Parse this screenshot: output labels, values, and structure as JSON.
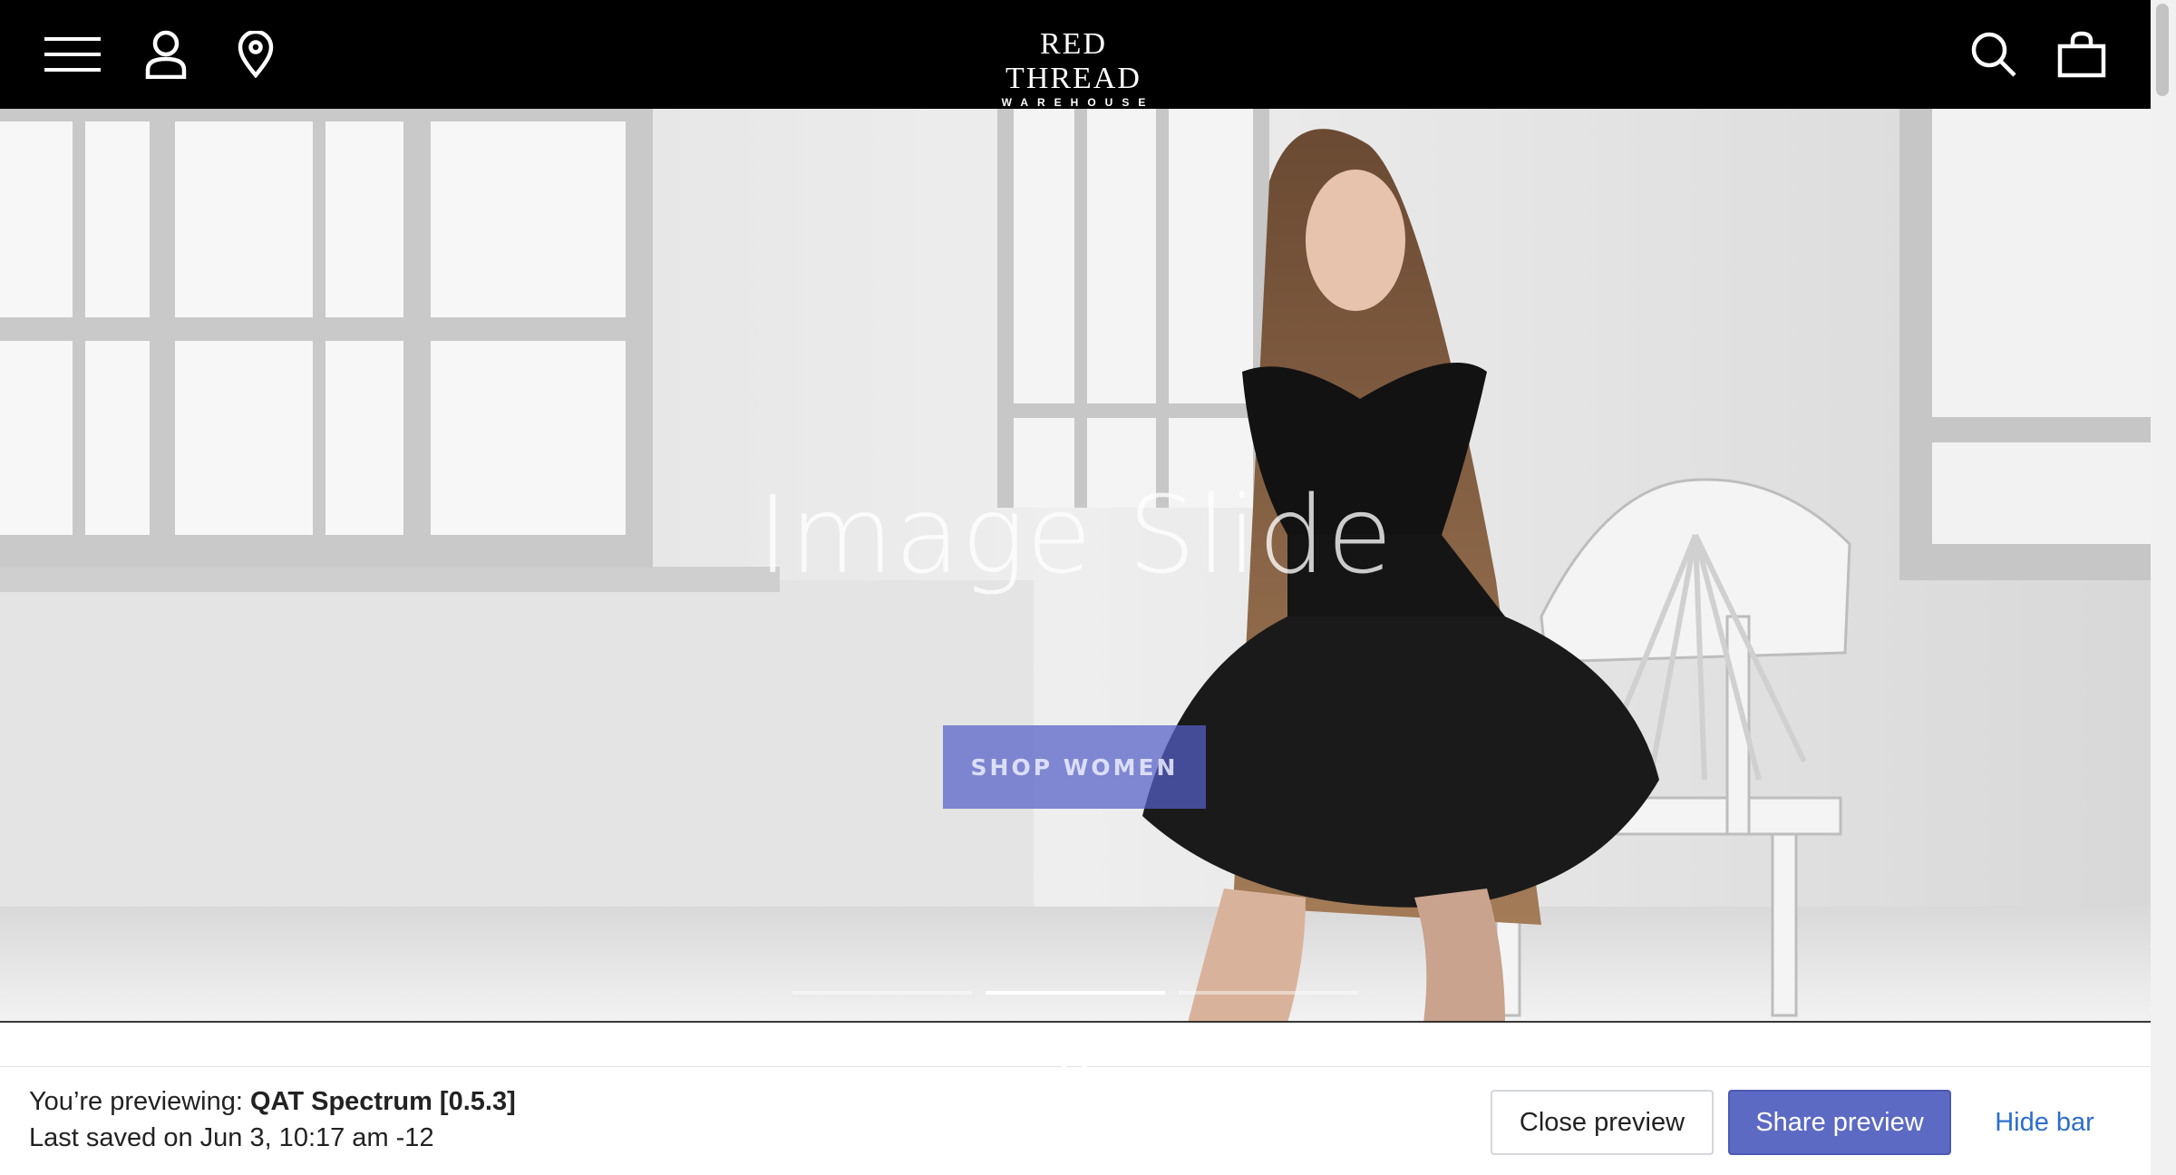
{
  "header": {
    "logo_line1": "RED THREAD",
    "logo_line2": "WAREHOUSE",
    "icons": [
      "menu-icon",
      "account-icon",
      "location-pin-icon",
      "search-icon",
      "shopping-bag-icon"
    ]
  },
  "hero": {
    "slide_title": "Image Slide",
    "cta_label": "SHOP WOMEN",
    "slide_indicators": 3,
    "active_slide": 2,
    "accent_color": "#5c6ac4"
  },
  "preview_bar": {
    "previewing_prefix": "You’re previewing:",
    "theme_name": "QAT Spectrum [0.5.3]",
    "last_saved": "Last saved on Jun 3, 10:17 am -12",
    "close_label": "Close preview",
    "share_label": "Share preview",
    "hide_label": "Hide bar"
  }
}
